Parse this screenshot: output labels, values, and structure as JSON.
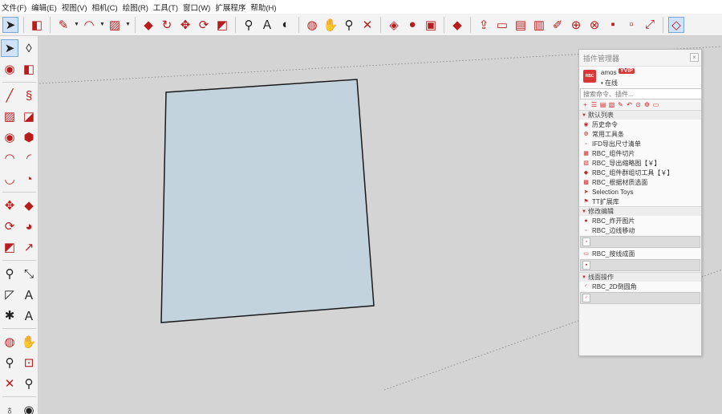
{
  "menu": [
    "文件(F)",
    "编辑(E)",
    "视图(V)",
    "相机(C)",
    "绘图(R)",
    "工具(T)",
    "窗口(W)",
    "扩展程序",
    "帮助(H)"
  ],
  "toolbar_icons": [
    "select-arrow",
    "eraser",
    "pencil",
    "arc",
    "rectangle",
    "push-pull",
    "follow-me",
    "move",
    "rotate",
    "scale",
    "tape-measure",
    "text",
    "paint-bucket",
    "orbit",
    "pan",
    "zoom",
    "zoom-extents",
    "components",
    "materials",
    "styles",
    "warehouse",
    "export",
    "folder",
    "new-file",
    "replace-file",
    "pen",
    "download",
    "upload",
    "pm",
    "font",
    "expand",
    "extension-gem"
  ],
  "plugin_panel": {
    "title": "插件管理器",
    "close": "×",
    "logo": "RBC",
    "username": "amos",
    "vip": "YVIP",
    "status": "• 在线",
    "search_placeholder": "搜索命令、插件...",
    "categories": [
      {
        "label": "默认列表",
        "items": [
          {
            "icon": "history-icon",
            "label": "历史命令"
          },
          {
            "icon": "tools-icon",
            "label": "常用工具条"
          },
          {
            "icon": "doc-icon",
            "label": "IFD导出尺寸清单"
          },
          {
            "icon": "component-cut-icon",
            "label": "RBC_组件切片"
          },
          {
            "icon": "export-icon",
            "label": "RBC_导出缩略图【￥】"
          },
          {
            "icon": "group-cut-icon",
            "label": "RBC_组件群组切工具【￥】"
          },
          {
            "icon": "material-icon",
            "label": "RBC_根据材质选面"
          },
          {
            "icon": "selection-icon",
            "label": "Selection Toys"
          },
          {
            "icon": "tt-icon",
            "label": "TT扩展库"
          }
        ]
      },
      {
        "label": "修改编辑",
        "items": [
          {
            "icon": "explode-icon",
            "label": "RBC_炸开图片"
          },
          {
            "icon": "edge-icon",
            "label": "RBC_边线移动"
          }
        ],
        "slots": 1,
        "tail": [
          {
            "icon": "line-face-icon",
            "label": "RBC_按线成面"
          }
        ],
        "tail_slots": 1
      },
      {
        "label": "线面操作",
        "items": [
          {
            "icon": "2d-icon",
            "label": "RBC_2D倒圆角"
          }
        ],
        "slots": 1
      }
    ]
  },
  "colors": {
    "face_fill": "#c3d3de",
    "face_stroke": "#1a1a1a",
    "accent_red": "#d12a2a"
  }
}
